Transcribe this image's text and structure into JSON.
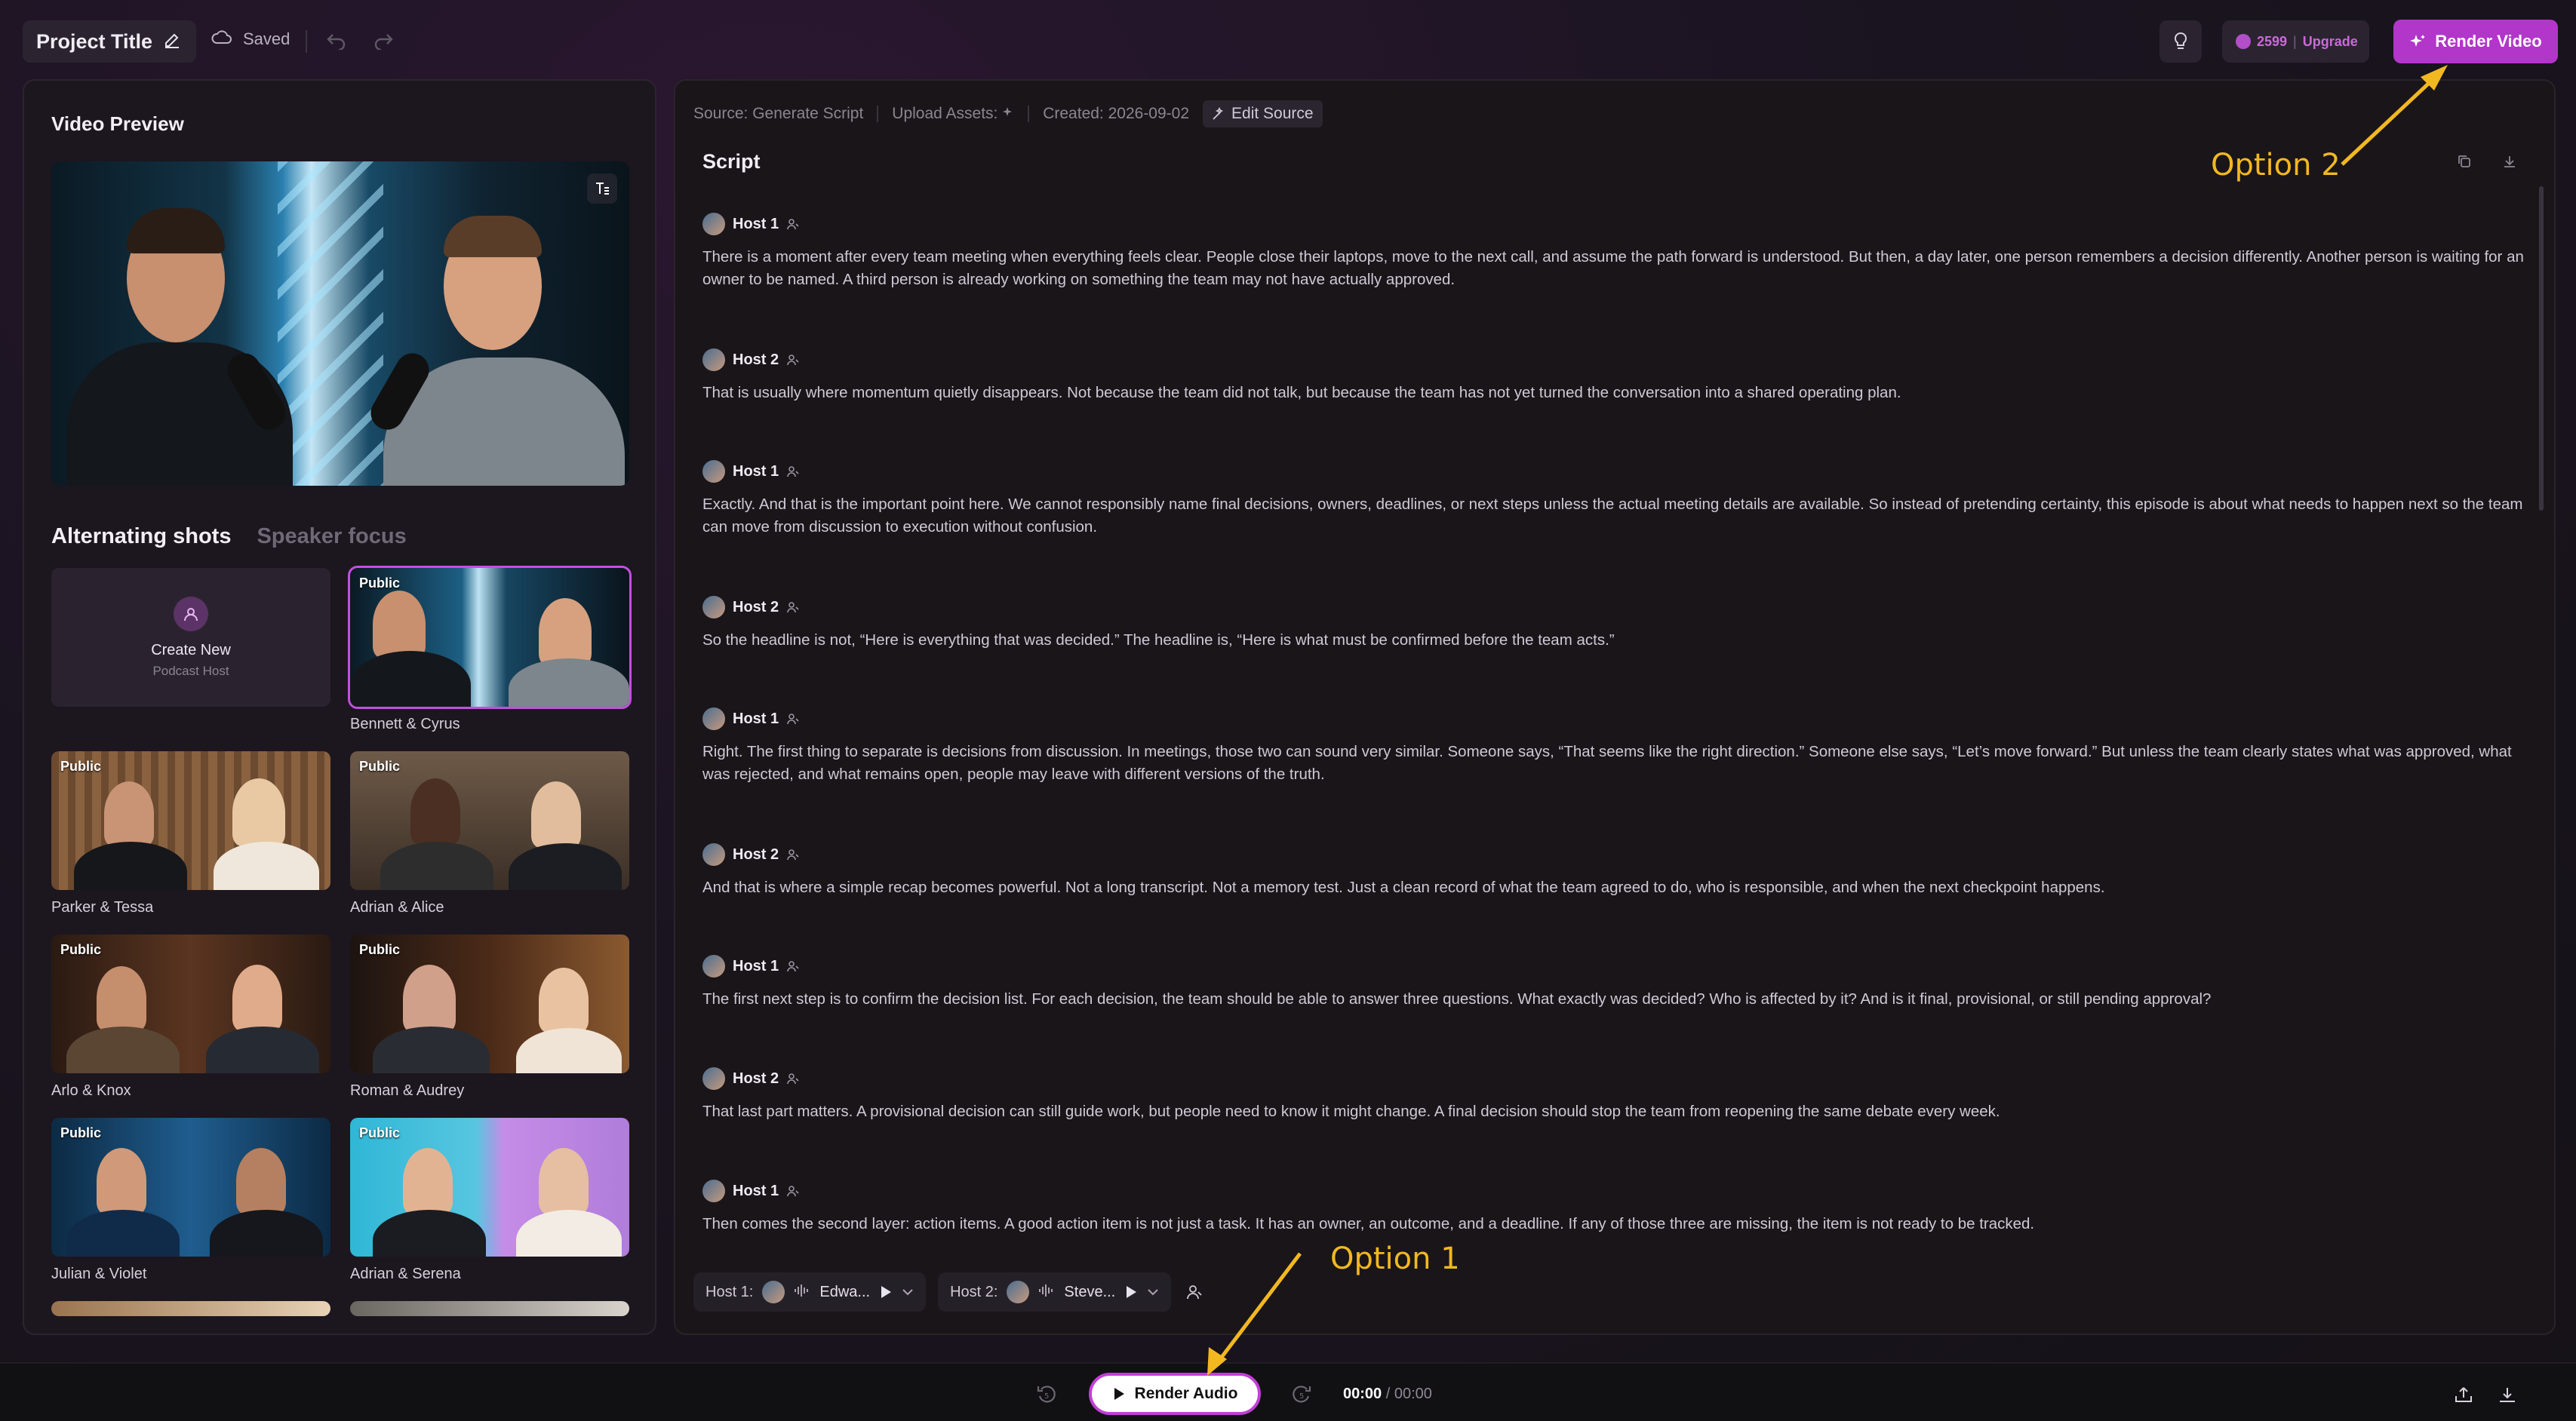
{
  "topbar": {
    "project_title": "Project Title",
    "saved_label": "Saved",
    "credits": "2599",
    "upgrade_label": "Upgrade",
    "render_video_label": "Render Video"
  },
  "left_panel": {
    "title": "Video Preview",
    "tabs": [
      {
        "label": "Alternating shots",
        "active": true
      },
      {
        "label": "Speaker focus",
        "active": false
      }
    ],
    "create_new": {
      "title": "Create New",
      "subtitle": "Podcast Host"
    },
    "hosts": [
      {
        "label": "Bennett & Cyrus",
        "badge": "Public",
        "selected": true
      },
      {
        "label": "Parker & Tessa",
        "badge": "Public"
      },
      {
        "label": "Adrian & Alice",
        "badge": "Public"
      },
      {
        "label": "Arlo & Knox",
        "badge": "Public"
      },
      {
        "label": "Roman & Audrey",
        "badge": "Public"
      },
      {
        "label": "Julian & Violet",
        "badge": "Public"
      },
      {
        "label": "Adrian & Serena",
        "badge": "Public"
      }
    ]
  },
  "right_panel": {
    "meta": {
      "source": "Source: Generate Script",
      "upload_assets": "Upload Assets:",
      "created": "Created: 2026-09-02",
      "edit_source": "Edit Source"
    },
    "script_title": "Script",
    "turns": [
      {
        "speaker": "Host 1",
        "text": "There is a moment after every team meeting when everything feels clear. People close their laptops, move to the next call, and assume the path forward is understood. But then, a day later, one person remembers a decision differently. Another person is waiting for an owner to be named. A third person is already working on something the team may not have actually approved."
      },
      {
        "speaker": "Host 2",
        "text": "That is usually where momentum quietly disappears. Not because the team did not talk, but because the team has not yet turned the conversation into a shared operating plan."
      },
      {
        "speaker": "Host 1",
        "text": "Exactly. And that is the important point here. We cannot responsibly name final decisions, owners, deadlines, or next steps unless the actual meeting details are available. So instead of pretending certainty, this episode is about what needs to happen next so the team can move from discussion to execution without confusion."
      },
      {
        "speaker": "Host 2",
        "text": "So the headline is not, “Here is everything that was decided.” The headline is, “Here is what must be confirmed before the team acts.”"
      },
      {
        "speaker": "Host 1",
        "text": "Right. The first thing to separate is decisions from discussion. In meetings, those two can sound very similar. Someone says, “That seems like the right direction.” Someone else says, “Let’s move forward.” But unless the team clearly states what was approved, what was rejected, and what remains open, people may leave with different versions of the truth."
      },
      {
        "speaker": "Host 2",
        "text": "And that is where a simple recap becomes powerful. Not a long transcript. Not a memory test. Just a clean record of what the team agreed to do, who is responsible, and when the next checkpoint happens."
      },
      {
        "speaker": "Host 1",
        "text": "The first next step is to confirm the decision list. For each decision, the team should be able to answer three questions. What exactly was decided? Who is affected by it? And is it final, provisional, or still pending approval?"
      },
      {
        "speaker": "Host 2",
        "text": "That last part matters. A provisional decision can still guide work, but people need to know it might change. A final decision should stop the team from reopening the same debate every week."
      },
      {
        "speaker": "Host 1",
        "text": "Then comes the second layer: action items. A good action item is not just a task. It has an owner, an outcome, and a deadline. If any of those three are missing, the item is not ready to be tracked."
      }
    ],
    "host_bar": {
      "host1_label": "Host 1:",
      "host1_voice": "Edwa...",
      "host2_label": "Host 2:",
      "host2_voice": "Steve..."
    }
  },
  "bottombar": {
    "render_audio_label": "Render Audio",
    "rewind_seconds": "5",
    "forward_seconds": "5",
    "time_current": "00:00",
    "time_total": "/ 00:00"
  },
  "annotations": {
    "option1": "Option 1",
    "option2": "Option 2"
  },
  "colors": {
    "accent": "#b236c9",
    "annotation": "#f2b820"
  }
}
